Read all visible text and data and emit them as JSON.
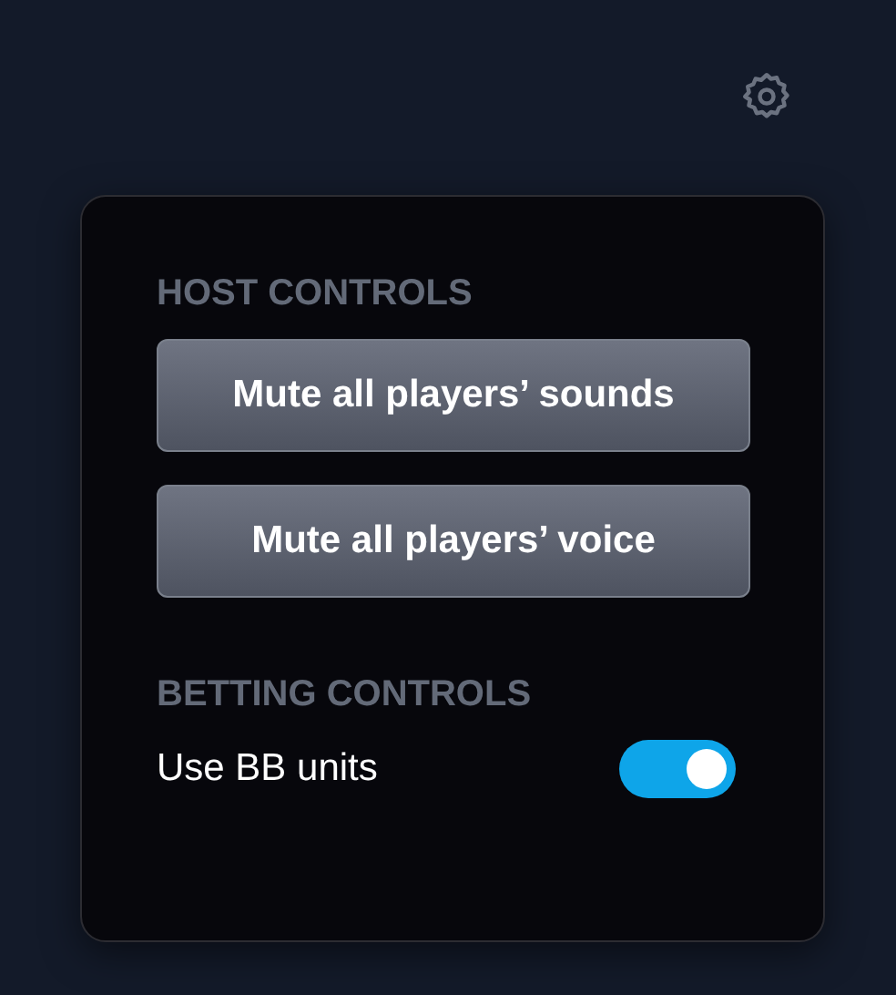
{
  "panel": {
    "sections": [
      {
        "kind": "buttons",
        "title": "HOST CONTROLS",
        "buttons": [
          "Mute all players’ sounds",
          "Mute all players’ voice"
        ]
      },
      {
        "kind": "toggles",
        "title": "BETTING CONTROLS",
        "toggles": [
          {
            "label": "Use BB units",
            "on": true
          }
        ]
      }
    ]
  }
}
